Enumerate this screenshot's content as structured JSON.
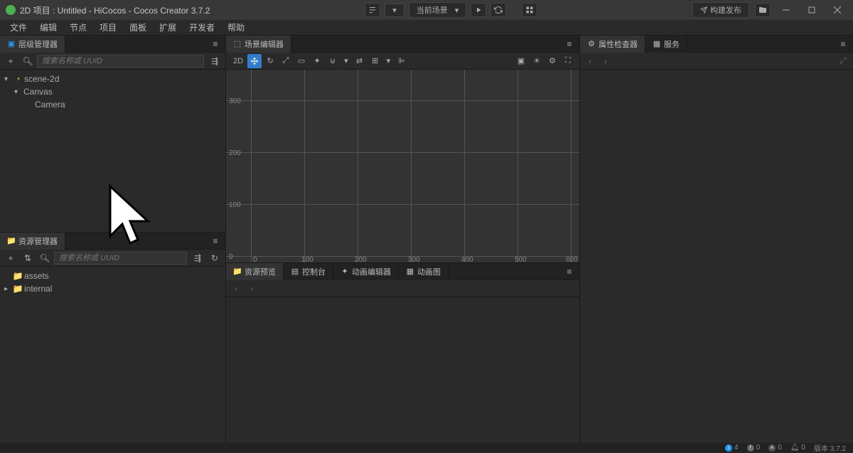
{
  "window": {
    "title": "2D 项目 : Untitled - HiCocos - Cocos Creator 3.7.2",
    "scene_dropdown": "当前场景",
    "build_label": "构建发布"
  },
  "menus": [
    "文件",
    "编辑",
    "节点",
    "项目",
    "面板",
    "扩展",
    "开发者",
    "帮助"
  ],
  "panels": {
    "hierarchy": {
      "title": "层级管理器",
      "search_placeholder": "搜索名称或 UUID",
      "tree": [
        {
          "level": 0,
          "expanded": true,
          "icon": "scene",
          "label": "scene-2d"
        },
        {
          "level": 1,
          "expanded": true,
          "icon": "none",
          "label": "Canvas"
        },
        {
          "level": 2,
          "expanded": false,
          "icon": "none",
          "label": "Camera"
        }
      ]
    },
    "assets": {
      "title": "资源管理器",
      "search_placeholder": "搜索名称或 UUID",
      "tree": [
        {
          "level": 0,
          "expanded": false,
          "chevron": false,
          "icon": "folder-gold",
          "label": "assets"
        },
        {
          "level": 0,
          "expanded": false,
          "chevron": true,
          "icon": "folder-blue",
          "label": "internal"
        }
      ]
    },
    "scene": {
      "title": "场景编辑器",
      "mode_label": "2D",
      "axis_x": [
        "0",
        "100",
        "200",
        "300",
        "400",
        "500",
        "600"
      ],
      "axis_y": [
        "0",
        "100",
        "200",
        "300"
      ]
    },
    "preview": {
      "tabs": [
        "资源预览",
        "控制台",
        "动画编辑器",
        "动画图"
      ]
    },
    "inspector": {
      "tabs": [
        "属性检查器",
        "服务"
      ]
    }
  },
  "status": {
    "info": "4",
    "warn": "0",
    "error": "0",
    "notif": "0",
    "version": "版本 3.7.2"
  }
}
